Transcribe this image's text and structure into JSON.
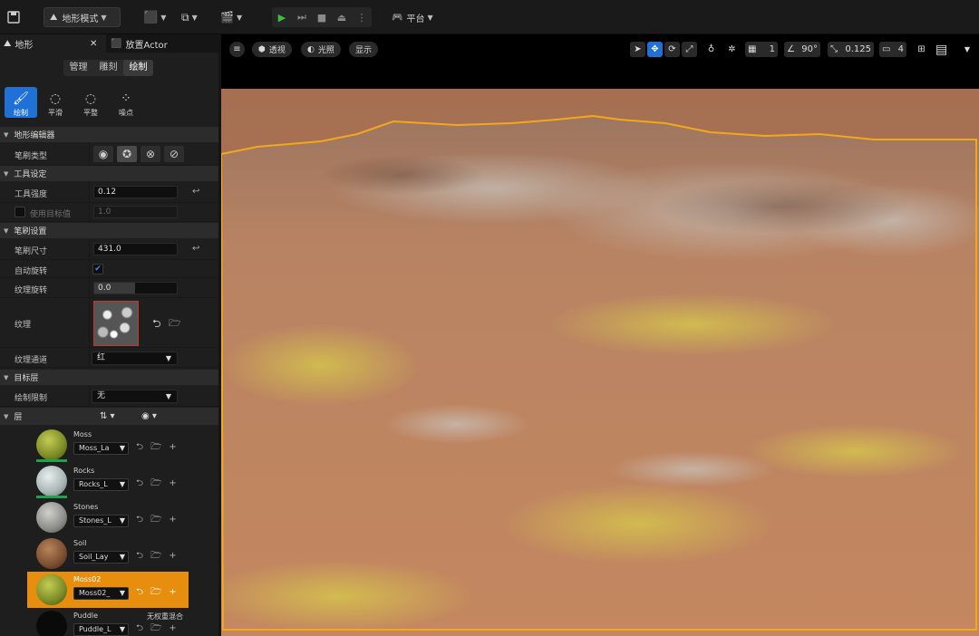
{
  "toolbar": {
    "mode_label": "地形模式",
    "platform_label": "平台"
  },
  "tabs": [
    {
      "label": "地形"
    },
    {
      "label": "放置Actor"
    }
  ],
  "mode_tabs": [
    "管理",
    "雕刻",
    "绘制"
  ],
  "tools": [
    "绘制",
    "平滑",
    "平整",
    "噪点"
  ],
  "sections": {
    "landscape_editor": "地形编辑器",
    "tool_settings": "工具设定",
    "brush_settings": "笔刷设置",
    "target_layer": "目标层",
    "layers": "层"
  },
  "props": {
    "brush_type": "笔刷类型",
    "tool_strength": {
      "label": "工具强度",
      "value": "0.12"
    },
    "use_target_value": {
      "label": "使用目标值",
      "value": "1.0"
    },
    "brush_size": {
      "label": "笔刷尺寸",
      "value": "431.0"
    },
    "auto_rotate": {
      "label": "自动旋转",
      "checked": true
    },
    "texture_rotation": {
      "label": "纹理旋转",
      "value": "0.0"
    },
    "texture": {
      "label": "纹理"
    },
    "texture_channel": {
      "label": "纹理通道",
      "value": "红"
    },
    "paint_restriction": {
      "label": "绘制限制",
      "value": "无"
    }
  },
  "layers": [
    {
      "name": "Moss",
      "dropdown": "Moss_La",
      "color": "#9aa53a"
    },
    {
      "name": "Rocks",
      "dropdown": "Rocks_L",
      "color": "#b8c0c0"
    },
    {
      "name": "Stones",
      "dropdown": "Stones_L",
      "color": "#9a9a96"
    },
    {
      "name": "Soil",
      "dropdown": "Soil_Lay",
      "color": "#8a5a3a"
    },
    {
      "name": "Moss02",
      "dropdown": "Moss02_",
      "color": "#9aa53a",
      "selected": true
    },
    {
      "name": "Puddle",
      "dropdown": "Puddle_L",
      "color": "#111111",
      "extra": "无权重混合"
    }
  ],
  "viewport": {
    "perspective": "透视",
    "lighting": "光照",
    "show": "显示",
    "grid_value": "1",
    "angle_value": "90°",
    "scale_value": "0.125",
    "camera_speed": "4"
  },
  "colors": {
    "accent": "#1f71d8",
    "selected_layer": "#e78e0f",
    "boundary": "#f2a81d"
  }
}
